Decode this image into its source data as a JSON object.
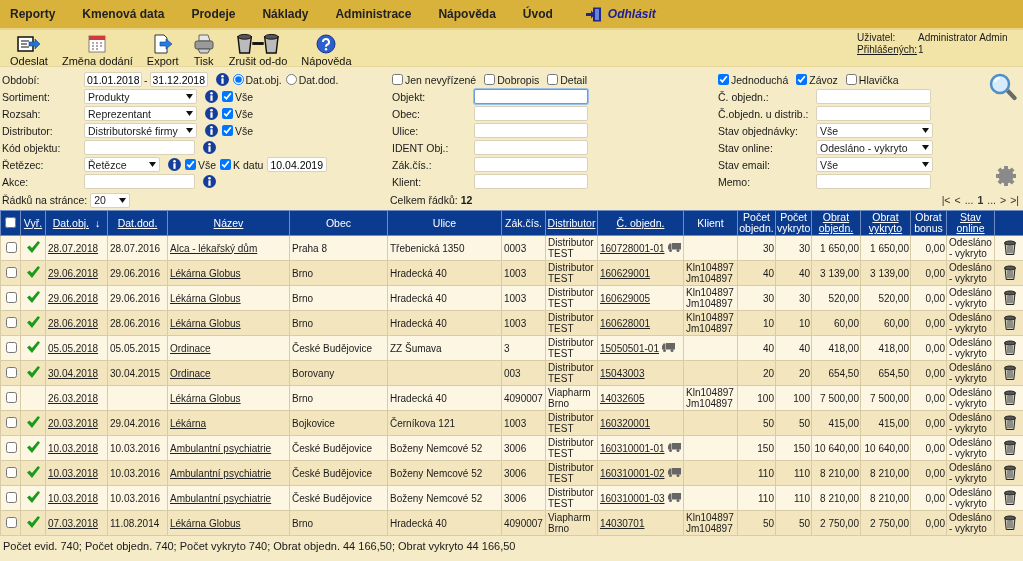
{
  "menu": [
    {
      "label": "Reporty",
      "kind": "menu"
    },
    {
      "label": "Kmenová data",
      "kind": "menu"
    },
    {
      "label": "Prodeje",
      "kind": "menu"
    },
    {
      "label": "Náklady",
      "kind": "menu"
    },
    {
      "label": "Administrace",
      "kind": "menu"
    },
    {
      "label": "Nápověda",
      "kind": "menu"
    },
    {
      "label": "Úvod",
      "kind": "menu"
    },
    {
      "label": "Odhlásit",
      "kind": "logout"
    }
  ],
  "toolbar": [
    {
      "label": "Odeslat",
      "kind": "send"
    },
    {
      "label": "Změna dodání",
      "kind": "calendar"
    },
    {
      "label": "Export",
      "kind": "export"
    },
    {
      "label": "Tisk",
      "kind": "print"
    },
    {
      "label": "Zrušit od-do",
      "kind": "cancel"
    },
    {
      "label": "Nápověda",
      "kind": "help"
    }
  ],
  "user": {
    "label": "Uživatel:",
    "value": "Administrator Admin"
  },
  "logged_in": {
    "label": "Přihlášených:",
    "value": "1"
  },
  "left_filters": [
    {
      "kind": "daterange",
      "label": "Období:",
      "from": "01.01.2018",
      "separator": "-",
      "to": "31.12.2018",
      "radios": [
        {
          "label": "Dat.obj.",
          "selected": true
        },
        {
          "label": "Dat.dod.",
          "selected": false
        }
      ]
    },
    {
      "kind": "select",
      "label": "Sortiment:",
      "value": "Produkty",
      "all": {
        "label": "Vše",
        "checked": true
      }
    },
    {
      "kind": "select",
      "label": "Rozsah:",
      "value": "Reprezentant",
      "all": {
        "label": "Vše",
        "checked": true
      }
    },
    {
      "kind": "select",
      "label": "Distributor:",
      "value": "Distributorské firmy",
      "all": {
        "label": "Vše",
        "checked": true
      }
    },
    {
      "kind": "input",
      "label": "Kód objektu:"
    },
    {
      "kind": "chain",
      "label": "Řetězec:",
      "value": "Řetězce",
      "all": {
        "label": "Vše",
        "checked": true
      },
      "at_date": {
        "label": "K datu",
        "checked": true
      },
      "date": "10.04.2019"
    },
    {
      "kind": "input",
      "label": "Akce:"
    }
  ],
  "middle_checks": [
    {
      "label": "Jen nevyřízené",
      "checked": false
    },
    {
      "label": "Dobropis",
      "checked": false
    },
    {
      "label": "Detail",
      "checked": false
    }
  ],
  "middle_fields": [
    {
      "label": "Objekt:",
      "focused": true
    },
    {
      "label": "Obec:",
      "focused": false
    },
    {
      "label": "Ulice:",
      "focused": false
    },
    {
      "label": "IDENT Obj.:",
      "focused": false
    },
    {
      "label": "Zák.čís.:",
      "focused": false
    },
    {
      "label": "Klient:",
      "focused": false
    }
  ],
  "right_checks": [
    {
      "label": "Jednoduchá",
      "checked": true
    },
    {
      "label": "Závoz",
      "checked": true
    },
    {
      "label": "Hlavička",
      "checked": false
    }
  ],
  "right_fields": [
    {
      "kind": "input",
      "label": "Č. objedn.:"
    },
    {
      "kind": "input",
      "label": "Č.objedn. u distrib.:"
    },
    {
      "kind": "select",
      "label": "Stav objednávky:",
      "value": "Vše"
    },
    {
      "kind": "select",
      "label": "Stav online:",
      "value": "Odesláno - vykryto"
    },
    {
      "kind": "select",
      "label": "Stav email:",
      "value": "Vše"
    },
    {
      "kind": "input",
      "label": "Memo:"
    }
  ],
  "rows_per_page": {
    "label": "Řádků na stránce:",
    "value": "20"
  },
  "total": {
    "label": "Celkem řádků:",
    "value": "12"
  },
  "pager": [
    {
      "label": "|<",
      "selected": false
    },
    {
      "label": "<",
      "selected": false
    },
    {
      "label": "...",
      "selected": false
    },
    {
      "label": "1",
      "selected": true
    },
    {
      "label": "...",
      "selected": false
    },
    {
      "label": ">",
      "selected": false
    },
    {
      "label": ">|",
      "selected": false
    }
  ],
  "columns": [
    {
      "kind": "check",
      "checked": false
    },
    {
      "kind": "text",
      "label": "Vyř.",
      "link": true
    },
    {
      "kind": "text",
      "label": "Dat.obj.",
      "link": true,
      "sort_arrow": "↓"
    },
    {
      "kind": "text",
      "label": "Dat.dod.",
      "link": true
    },
    {
      "kind": "text",
      "label": "Název",
      "link": true
    },
    {
      "kind": "text",
      "label": "Obec",
      "link": false
    },
    {
      "kind": "text",
      "label": "Ulice",
      "link": false
    },
    {
      "kind": "text",
      "label": "Zák.čís.",
      "link": false
    },
    {
      "kind": "text",
      "label": "Distributor",
      "link": true
    },
    {
      "kind": "text",
      "label": "Č. objedn.",
      "link": true
    },
    {
      "kind": "text",
      "label": "Klient",
      "link": false
    },
    {
      "kind": "text",
      "label": "Počet objedn.",
      "link": false
    },
    {
      "kind": "text",
      "label": "Počet vykryto",
      "link": false
    },
    {
      "kind": "text",
      "label": "Obrat objedn.",
      "link": true
    },
    {
      "kind": "text",
      "label": "Obrat vykryto",
      "link": true
    },
    {
      "kind": "text",
      "label": "Obrat bonus",
      "link": false
    },
    {
      "kind": "text",
      "label": "Stav online",
      "link": true
    },
    {
      "kind": "blank"
    }
  ],
  "rows": [
    {
      "checked": false,
      "done": true,
      "date_order": "28.07.2018",
      "date_delivery": "28.07.2016",
      "name": "Alca - lékařský dům",
      "town": "Praha 8",
      "street": "Třebenická 1350",
      "customer_no": "0003",
      "distributor": "Distributor\nTEST",
      "order_no": "160728001-01",
      "delivery": true,
      "count_order": "30",
      "count_done": "30",
      "turnover_order": "1 650,00",
      "turnover_done": "1 650,00",
      "bonus": "0,00",
      "status": "Odesláno\n- vykryto"
    },
    {
      "checked": false,
      "done": true,
      "date_order": "29.06.2018",
      "date_delivery": "29.06.2016",
      "name": "Lékárna Globus",
      "town": "Brno",
      "street": "Hradecká 40",
      "customer_no": "1003",
      "distributor": "Distributor\nTEST",
      "order_no": "160629001",
      "delivery": false,
      "client": "Kln104897\nJm104897",
      "count_order": "40",
      "count_done": "40",
      "turnover_order": "3 139,00",
      "turnover_done": "3 139,00",
      "bonus": "0,00",
      "status": "Odesláno\n- vykryto"
    },
    {
      "checked": false,
      "done": true,
      "date_order": "29.06.2018",
      "date_delivery": "29.06.2016",
      "name": "Lékárna Globus",
      "town": "Brno",
      "street": "Hradecká 40",
      "customer_no": "1003",
      "distributor": "Distributor\nTEST",
      "order_no": "160629005",
      "delivery": false,
      "client": "Kln104897\nJm104897",
      "count_order": "30",
      "count_done": "30",
      "turnover_order": "520,00",
      "turnover_done": "520,00",
      "bonus": "0,00",
      "status": "Odesláno\n- vykryto"
    },
    {
      "checked": false,
      "done": true,
      "date_order": "28.06.2018",
      "date_delivery": "28.06.2016",
      "name": "Lékárna Globus",
      "town": "Brno",
      "street": "Hradecká 40",
      "customer_no": "1003",
      "distributor": "Distributor\nTEST",
      "order_no": "160628001",
      "delivery": false,
      "client": "Kln104897\nJm104897",
      "count_order": "10",
      "count_done": "10",
      "turnover_order": "60,00",
      "turnover_done": "60,00",
      "bonus": "0,00",
      "status": "Odesláno\n- vykryto"
    },
    {
      "checked": false,
      "done": true,
      "date_order": "05.05.2018",
      "date_delivery": "05.05.2015",
      "name": "Ordinace",
      "town": "České Budějovice",
      "street": "ZZ Šumava",
      "customer_no": "3",
      "distributor": "Distributor\nTEST",
      "order_no": "15050501-01",
      "delivery": true,
      "count_order": "40",
      "count_done": "40",
      "turnover_order": "418,00",
      "turnover_done": "418,00",
      "bonus": "0,00",
      "status": "Odesláno\n- vykryto"
    },
    {
      "checked": false,
      "done": true,
      "date_order": "30.04.2018",
      "date_delivery": "30.04.2015",
      "name": "Ordinace",
      "town": "Borovany",
      "customer_no": "003",
      "distributor": "Distributor\nTEST",
      "order_no": "15043003",
      "delivery": false,
      "count_order": "20",
      "count_done": "20",
      "turnover_order": "654,50",
      "turnover_done": "654,50",
      "bonus": "0,00",
      "status": "Odesláno\n- vykryto"
    },
    {
      "checked": false,
      "done": false,
      "date_order": "26.03.2018",
      "name": "Lékárna Globus",
      "town": "Brno",
      "street": "Hradecká 40",
      "customer_no": "4090007",
      "distributor": "Viapharm\nBrno",
      "order_no": "14032605",
      "delivery": false,
      "client": "Kln104897\nJm104897",
      "count_order": "100",
      "count_done": "100",
      "turnover_order": "7 500,00",
      "turnover_done": "7 500,00",
      "bonus": "0,00",
      "status": "Odesláno\n- vykryto"
    },
    {
      "checked": false,
      "done": true,
      "date_order": "20.03.2018",
      "date_delivery": "29.04.2016",
      "name": "Lékárna",
      "town": "Bojkovice",
      "street": "Černíkova 121",
      "customer_no": "1003",
      "distributor": "Distributor\nTEST",
      "order_no": "160320001",
      "delivery": false,
      "count_order": "50",
      "count_done": "50",
      "turnover_order": "415,00",
      "turnover_done": "415,00",
      "bonus": "0,00",
      "status": "Odesláno\n- vykryto"
    },
    {
      "checked": false,
      "done": true,
      "date_order": "10.03.2018",
      "date_delivery": "10.03.2016",
      "name": "Ambulantní psychiatrie",
      "town": "České Budějovice",
      "street": "Boženy Nemcové 52",
      "customer_no": "3006",
      "distributor": "Distributor\nTEST",
      "order_no": "160310001-01",
      "delivery": true,
      "count_order": "150",
      "count_done": "150",
      "turnover_order": "10 640,00",
      "turnover_done": "10 640,00",
      "bonus": "0,00",
      "status": "Odesláno\n- vykryto"
    },
    {
      "checked": false,
      "done": true,
      "date_order": "10.03.2018",
      "date_delivery": "10.03.2016",
      "name": "Ambulantní psychiatrie",
      "town": "České Budějovice",
      "street": "Boženy Nemcové 52",
      "customer_no": "3006",
      "distributor": "Distributor\nTEST",
      "order_no": "160310001-02",
      "delivery": true,
      "count_order": "110",
      "count_done": "110",
      "turnover_order": "8 210,00",
      "turnover_done": "8 210,00",
      "bonus": "0,00",
      "status": "Odesláno\n- vykryto"
    },
    {
      "checked": false,
      "done": true,
      "date_order": "10.03.2018",
      "date_delivery": "10.03.2016",
      "name": "Ambulantní psychiatrie",
      "town": "České Budějovice",
      "street": "Boženy Nemcové 52",
      "customer_no": "3006",
      "distributor": "Distributor\nTEST",
      "order_no": "160310001-03",
      "delivery": true,
      "count_order": "110",
      "count_done": "110",
      "turnover_order": "8 210,00",
      "turnover_done": "8 210,00",
      "bonus": "0,00",
      "status": "Odesláno\n- vykryto"
    },
    {
      "checked": false,
      "done": true,
      "date_order": "07.03.2018",
      "date_delivery": "11.08.2014",
      "name": "Lékárna Globus",
      "town": "Brno",
      "street": "Hradecká 40",
      "customer_no": "4090007",
      "distributor": "Viapharm\nBrno",
      "order_no": "14030701",
      "delivery": false,
      "client": "Kln104897\nJm104897",
      "count_order": "50",
      "count_done": "50",
      "turnover_order": "2 750,00",
      "turnover_done": "2 750,00",
      "bonus": "0,00",
      "status": "Odesláno\n- vykryto"
    }
  ],
  "summary": "Počet evid. 740; Počet objedn. 740; Počet vykryto 740; Obrat objedn. 44 166,50; Obrat vykryto 44 166,50"
}
